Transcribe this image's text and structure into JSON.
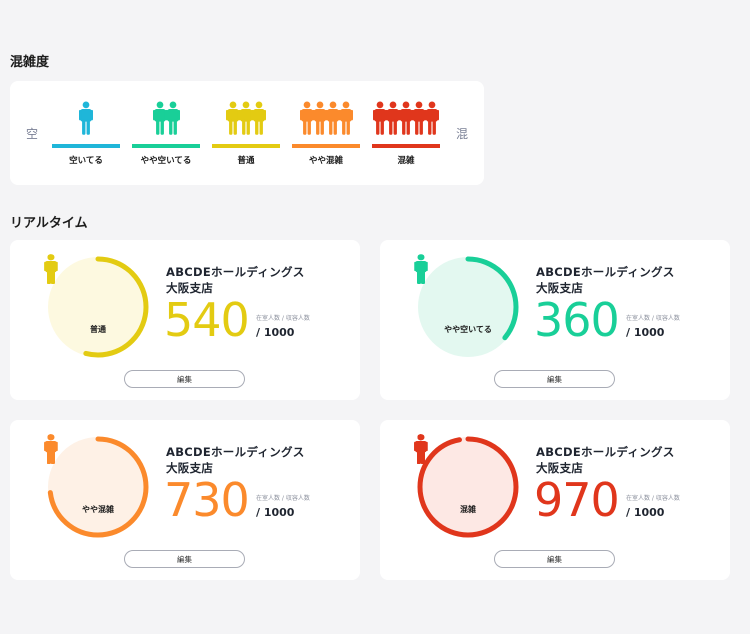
{
  "sections": {
    "congestion_title": "混雑度",
    "realtime_title": "リアルタイム"
  },
  "legend": {
    "left_end": "空",
    "right_end": "混",
    "levels": [
      {
        "label": "空いてる",
        "color": "#1fb6d9",
        "people": 1
      },
      {
        "label": "やや空いてる",
        "color": "#19cf98",
        "people": 2
      },
      {
        "label": "普通",
        "color": "#e3cb12",
        "people": 3
      },
      {
        "label": "やや混雑",
        "color": "#fb8a2c",
        "people": 4
      },
      {
        "label": "混雑",
        "color": "#e0361c",
        "people": 5
      }
    ]
  },
  "cards": [
    {
      "store": "ABCDEホールディングス",
      "branch": "大阪支店",
      "count": "540",
      "capacity": "/ 1000",
      "caption": "在室人数 / 収容人数",
      "status": "普通",
      "color": "#e3cb12",
      "bg": "#fdf9e0",
      "people": 3,
      "fill": 0.54,
      "edit_label": "編集"
    },
    {
      "store": "ABCDEホールディングス",
      "branch": "大阪支店",
      "count": "360",
      "capacity": "/ 1000",
      "caption": "在室人数 / 収容人数",
      "status": "やや空いてる",
      "color": "#19cf98",
      "bg": "#e3f8f0",
      "people": 2,
      "fill": 0.36,
      "edit_label": "編集"
    },
    {
      "store": "ABCDEホールディングス",
      "branch": "大阪支店",
      "count": "730",
      "capacity": "/ 1000",
      "caption": "在室人数 / 収容人数",
      "status": "やや混雑",
      "color": "#fb8a2c",
      "bg": "#fef1e6",
      "people": 4,
      "fill": 0.73,
      "edit_label": "編集"
    },
    {
      "store": "ABCDEホールディングス",
      "branch": "大阪支店",
      "count": "970",
      "capacity": "/ 1000",
      "caption": "在室人数 / 収容人数",
      "status": "混雑",
      "color": "#e0361c",
      "bg": "#fde8e4",
      "people": 5,
      "fill": 0.97,
      "edit_label": "編集"
    }
  ]
}
